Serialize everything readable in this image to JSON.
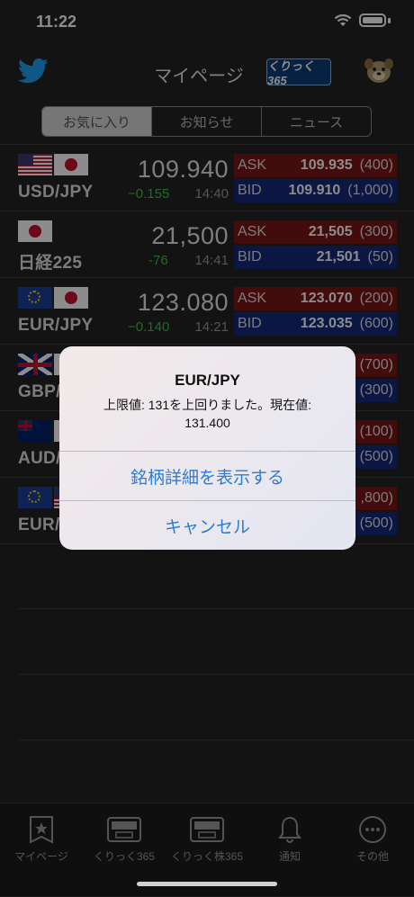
{
  "status_bar": {
    "time": "11:22"
  },
  "header": {
    "title": "マイページ",
    "logo_text": "くりっく365"
  },
  "segments": [
    {
      "label": "お気に入り",
      "active": true
    },
    {
      "label": "お知らせ",
      "active": false
    },
    {
      "label": "ニュース",
      "active": false
    }
  ],
  "rows": [
    {
      "flags": [
        "us",
        "jp"
      ],
      "pair": "USD/JPY",
      "rate": "109.940",
      "change": "−0.155",
      "time": "14:40",
      "ask": {
        "label": "ASK",
        "price": "109.935",
        "size": "(400)"
      },
      "bid": {
        "label": "BID",
        "price": "109.910",
        "size": "(1,000)"
      }
    },
    {
      "flags": [
        "jp"
      ],
      "pair": "日経225",
      "rate": "21,500",
      "change": "-76",
      "time": "14:41",
      "ask": {
        "label": "ASK",
        "price": "21,505",
        "size": "(300)"
      },
      "bid": {
        "label": "BID",
        "price": "21,501",
        "size": "(50)"
      }
    },
    {
      "flags": [
        "eu",
        "jp"
      ],
      "pair": "EUR/JPY",
      "rate": "123.080",
      "change": "−0.140",
      "time": "14:21",
      "ask": {
        "label": "ASK",
        "price": "123.070",
        "size": "(200)"
      },
      "bid": {
        "label": "BID",
        "price": "123.035",
        "size": "(600)"
      }
    },
    {
      "flags": [
        "gb",
        "jp"
      ],
      "pair": "GBP/JPY",
      "rate": "",
      "change": "",
      "time": "",
      "ask": {
        "label": "",
        "price": "",
        "size": "(700)"
      },
      "bid": {
        "label": "",
        "price": "",
        "size": "(300)"
      }
    },
    {
      "flags": [
        "au",
        "jp"
      ],
      "pair": "AUD/JPY",
      "rate": "",
      "change": "",
      "time": "",
      "ask": {
        "label": "",
        "price": "",
        "size": "(100)"
      },
      "bid": {
        "label": "",
        "price": "",
        "size": "(500)"
      }
    },
    {
      "flags": [
        "eu",
        "us"
      ],
      "pair": "EUR/USD",
      "rate": "",
      "change": "",
      "time": "",
      "ask": {
        "label": "",
        "price": "",
        "size": ",800)"
      },
      "bid": {
        "label": "",
        "price": "",
        "size": "(500)"
      }
    }
  ],
  "alert": {
    "title": "EUR/JPY",
    "message": "上限値: 131を上回りました。現在値: 131.400",
    "primary_button": "銘柄詳細を表示する",
    "cancel_button": "キャンセル"
  },
  "tabbar": [
    {
      "label": "マイページ",
      "icon": "star-page-icon"
    },
    {
      "label": "くりっく365",
      "icon": "click365-icon"
    },
    {
      "label": "くりっく株365",
      "icon": "click-kabu365-icon"
    },
    {
      "label": "通知",
      "icon": "bell-icon"
    },
    {
      "label": "その他",
      "icon": "more-icon"
    }
  ],
  "colors": {
    "ask_bg": "#7a1616",
    "bid_bg": "#15297a",
    "change_green": "#3fc04a",
    "alert_button": "#2b7cd6"
  }
}
